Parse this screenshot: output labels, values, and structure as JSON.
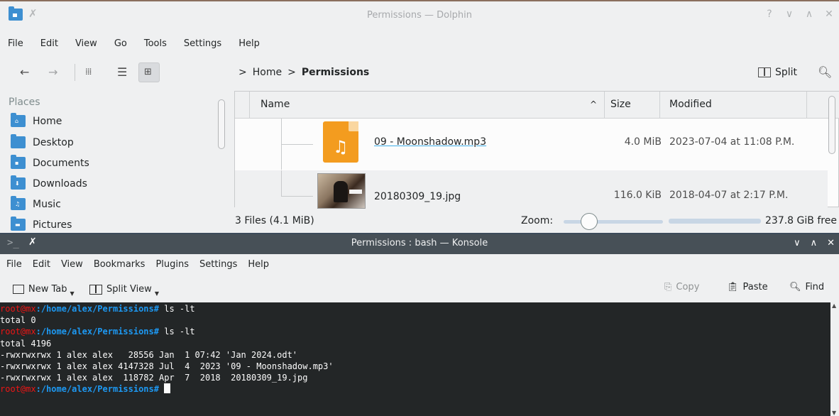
{
  "dolphin": {
    "title": "Permissions — Dolphin",
    "menu": [
      "File",
      "Edit",
      "View",
      "Go",
      "Tools",
      "Settings",
      "Help"
    ],
    "breadcrumb": {
      "sep1": ">",
      "home": "Home",
      "sep2": ">",
      "current": "Permissions"
    },
    "split_label": "Split",
    "places_title": "Places",
    "places": [
      {
        "label": "Home",
        "icon": "home-folder-icon"
      },
      {
        "label": "Desktop",
        "icon": "desktop-folder-icon"
      },
      {
        "label": "Documents",
        "icon": "documents-folder-icon"
      },
      {
        "label": "Downloads",
        "icon": "downloads-folder-icon"
      },
      {
        "label": "Music",
        "icon": "music-folder-icon"
      },
      {
        "label": "Pictures",
        "icon": "pictures-folder-icon"
      }
    ],
    "columns": {
      "name": "Name",
      "size": "Size",
      "modified": "Modified",
      "sort_indicator": "^"
    },
    "files": [
      {
        "name": "09 - Moonshadow.mp3",
        "size": "4.0 MiB",
        "modified": "2023-07-04 at 11:08 P.M.",
        "icon": "audio-file-icon"
      },
      {
        "name": "20180309_19.jpg",
        "size": "116.0 KiB",
        "modified": "2018-04-07 at 2:17 P.M.",
        "icon": "image-thumbnail"
      }
    ],
    "status": {
      "files": "3 Files (4.1 MiB)",
      "zoom_label": "Zoom:",
      "free_space": "237.8 GiB free"
    }
  },
  "konsole": {
    "title": "Permissions : bash — Konsole",
    "menu": [
      "File",
      "Edit",
      "View",
      "Bookmarks",
      "Plugins",
      "Settings",
      "Help"
    ],
    "toolbar": {
      "new_tab": "New Tab",
      "split_view": "Split View",
      "copy": "Copy",
      "paste": "Paste",
      "find": "Find"
    },
    "prompt": {
      "user": "root",
      "at": "@",
      "host": "mx",
      "path": ":/home/alex/Permissions",
      "symbol": "#"
    },
    "lines": [
      {
        "type": "prompt",
        "cmd": " ls -lt"
      },
      {
        "type": "out",
        "text": "total 0"
      },
      {
        "type": "prompt",
        "cmd": " ls -lt"
      },
      {
        "type": "out",
        "text": "total 4196"
      },
      {
        "type": "out",
        "text": "-rwxrwxrwx 1 alex alex   28556 Jan  1 07:42 'Jan 2024.odt'"
      },
      {
        "type": "out",
        "text": "-rwxrwxrwx 1 alex alex 4147328 Jul  4  2023 '09 - Moonshadow.mp3'"
      },
      {
        "type": "out",
        "text": "-rwxrwxrwx 1 alex alex  118782 Apr  7  2018  20180309_19.jpg"
      },
      {
        "type": "prompt",
        "cmd": " ",
        "cursor": true
      }
    ]
  }
}
